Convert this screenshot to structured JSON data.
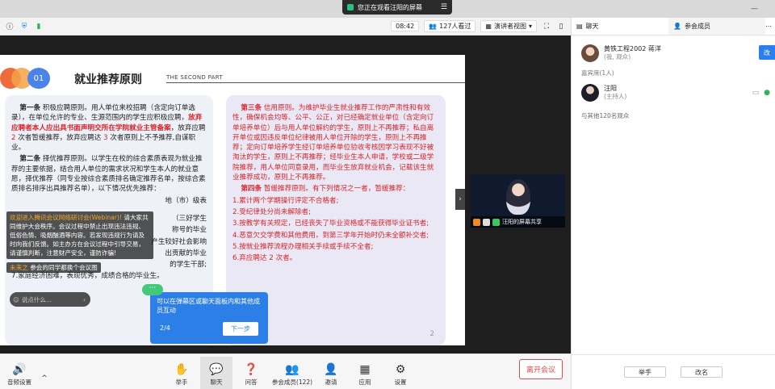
{
  "banner": {
    "text": "您正在观看汪阳的屏幕"
  },
  "topbar": {
    "time": "08:42",
    "viewers": "127人看过",
    "view_mode": "演讲者视图"
  },
  "slide": {
    "number": "01",
    "title": "就业推荐原则",
    "subtitle": "THE SECOND PART",
    "left": {
      "p1_head": "第一条",
      "p1_a": " 积极应聘原则。用人单位来校招聘（含定向订单选录），在单位允许的专业、生源范围内的学生应积极应聘，",
      "p1_red": "放弃应聘者本人应出具书面声明交所在学院就业主管备案",
      "p1_b": "，放弃应聘 ",
      "p1_n1": "2",
      "p1_c": " 次者暂缓推荐，放弃应聘达 ",
      "p1_n2": "3",
      "p1_d": " 次者原则上不予推荐,自谋职业。",
      "p2_head": "第二条",
      "p2_a": " 择优推荐原则。以学生在校的综合素质表现为就业推荐的主要依据，结合用人单位的需求状况和学生本人的就业意愿，择优推荐（同专业按综合素质排名确定推荐名单，按综合素质排名排序出具推荐名单），以下情况优先推荐：",
      "p2_b": "地（市）级表",
      "p2_c": "（三好学生",
      "p2_d": "称号的毕业",
      "p2_e": "产生较好社会影响",
      "p2_f": "出贡献的毕业",
      "p2_g": "的学生干部;",
      "p2_h": "7.家庭经济困难，表现优秀，成绩合格的毕业生。"
    },
    "right": {
      "p3_head": "第三条",
      "p3_red": " 信用原则。为维护毕业生就业推荐工作的严肃性和有效性，确保机会均等、公平、公正，对已经确定就业单位（含定向订单培养单位）后与用人单位解约的学生，原则上不再推荐；私自离开单位或因违反单位纪律被用人单位开除的学生，原则上不再推荐；定向订单培养学生经订单培养单位验收考核因学习表现不好被淘汰的学生，原则上不再推荐；经毕业生本人申请，学校或二级学院推荐，用人单位同意录用，而毕业生放弃就业机会，记载该生就业推荐成功，原则上不再推荐。",
      "p4_head": "第四条",
      "p4_a": " 暂缓推荐原则。有下列情况之一者，暂缓推荐：",
      "items": [
        "1.累计两个学期操行评定不合格者;",
        "2.受纪律处分尚未解除者;",
        "3.按教学有关规定，已经丧失了毕业资格或不能获得毕业证书者;",
        "4.恶意欠交学费和其他费用，到第三学年开始时仍未全额补交者;",
        "5.按就业推荐流程办理相关手续或手续不全者;",
        "6.弃应聘达 2 次者。"
      ],
      "page": "2"
    }
  },
  "chat_overlay": {
    "notice_head": "欢迎进入腾讯会议网络研讨会(Webinar)!",
    "notice_body": "请大家共同维护大会秩序。会议过程中禁止出现违法违规、低俗色情、吸烟酗酒等内容。若发现违规行为请及时向我们反馈。如主办方在会议过程中引导交易，请谨慎判断，注意财产安全，谨防诈骗!",
    "msg_name": "未来之",
    "msg_text": "参会的同学都换个会议图",
    "input_placeholder": "说点什么..."
  },
  "tooltip": {
    "text": "可以在弹幕区或聊天面板内和其他成员互动",
    "step": "2/4",
    "next": "下一步"
  },
  "video": {
    "label": "汪阳的屏幕共享"
  },
  "toolbar": {
    "audio": "音频设置",
    "raise": "举手",
    "chat": "聊天",
    "qa": "问答",
    "members": "参会成员(122)",
    "invite": "邀请",
    "apps": "应用",
    "settings": "设置",
    "leave": "离开会议"
  },
  "panel": {
    "tab_chat": "聊天",
    "tab_members": "参会成员",
    "me_name": "黄铁工程2002 蒋洋",
    "me_role": "(我, 观众)",
    "change_btn": "改",
    "guests_label": "嘉宾席(1人)",
    "host_name": "汪阳",
    "host_role": "(主持人)",
    "others": "与其他120名观众",
    "raise_btn": "举手",
    "rename_btn": "改名"
  },
  "colors": {
    "accent": "#2a7ff0",
    "leave": "#e34a4a",
    "highlight_red": "#d8232a"
  }
}
